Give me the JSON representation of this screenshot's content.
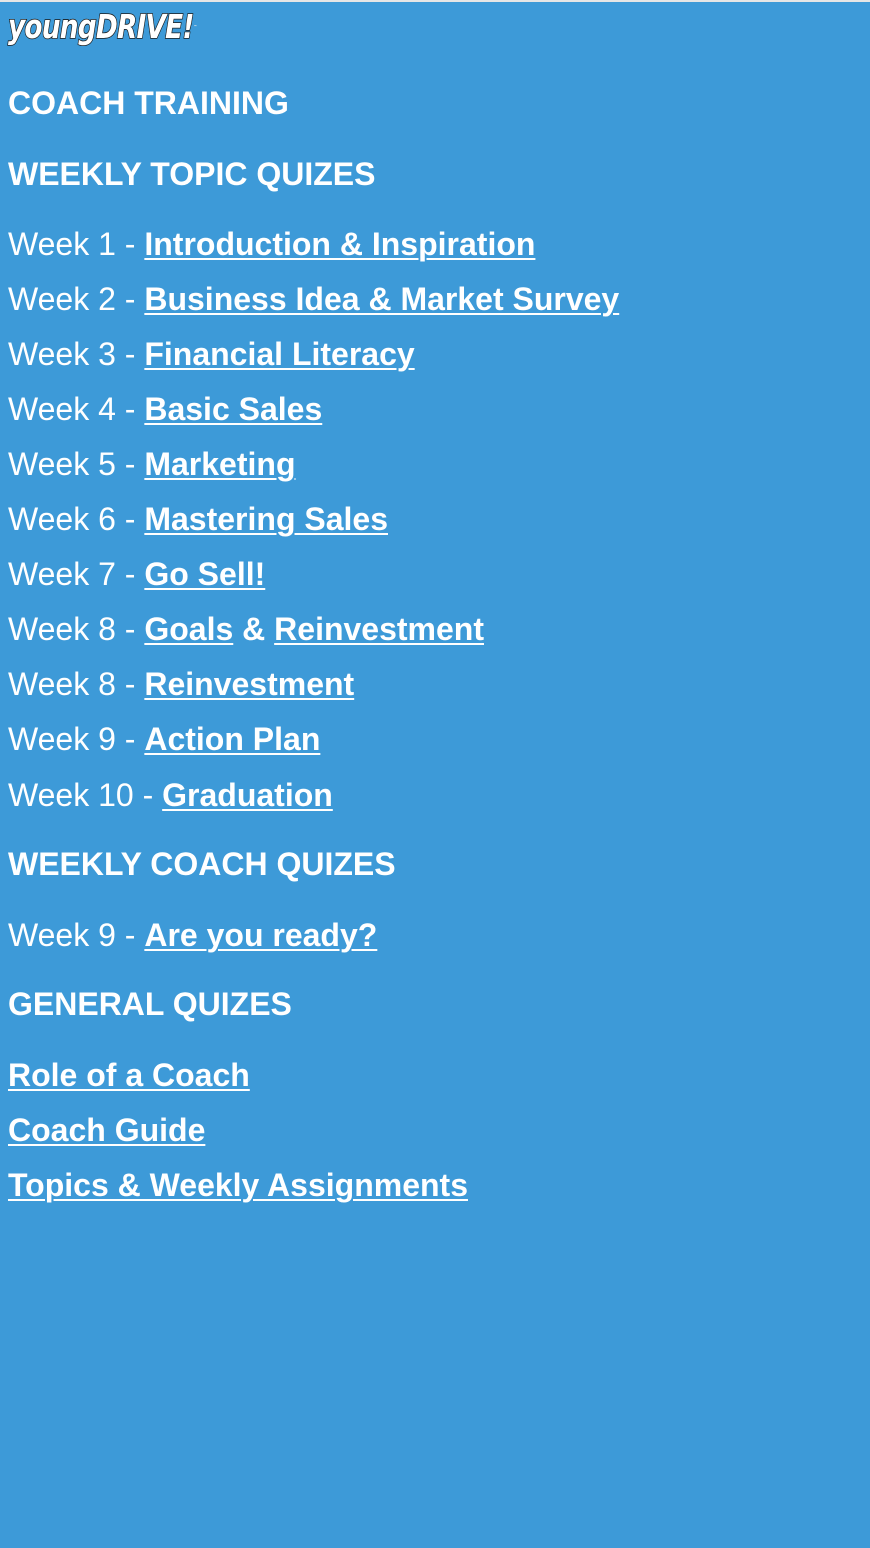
{
  "logo": {
    "text": "youngDRIVE!",
    "tm": "™"
  },
  "page_title": "COACH TRAINING",
  "weekly_topic": {
    "heading": "WEEKLY TOPIC QUIZES",
    "items": [
      {
        "week": "Week 1 - ",
        "link": "Introduction & Inspiration"
      },
      {
        "week": "Week 2 - ",
        "link": "Business Idea & Market Survey"
      },
      {
        "week": "Week 3 - ",
        "link": "Financial Literacy"
      },
      {
        "week": "Week 4 - ",
        "link": "Basic Sales"
      },
      {
        "week": "Week 5 - ",
        "link": "Marketing"
      },
      {
        "week": "Week 6 - ",
        "link": "Mastering Sales"
      },
      {
        "week": "Week 7 - ",
        "link": "Go Sell!"
      },
      {
        "week": "Week 8 - ",
        "link": "Goals",
        "sep": " & ",
        "link2": "Reinvestment"
      },
      {
        "week": "Week 8 - ",
        "link": "Reinvestment"
      },
      {
        "week": "Week 9 - ",
        "link": "Action Plan"
      },
      {
        "week": "Week 10 - ",
        "link": "Graduation"
      }
    ]
  },
  "weekly_coach": {
    "heading": "WEEKLY COACH QUIZES",
    "items": [
      {
        "week": "Week 9 - ",
        "link": "Are you ready?"
      }
    ]
  },
  "general": {
    "heading": "GENERAL QUIZES",
    "links": [
      "Role of a Coach",
      "Coach Guide",
      "Topics & Weekly Assignments"
    ]
  },
  "colors": {
    "background": "#3d9ad8",
    "text": "#ffffff",
    "top_border": "#e6e6e6"
  }
}
